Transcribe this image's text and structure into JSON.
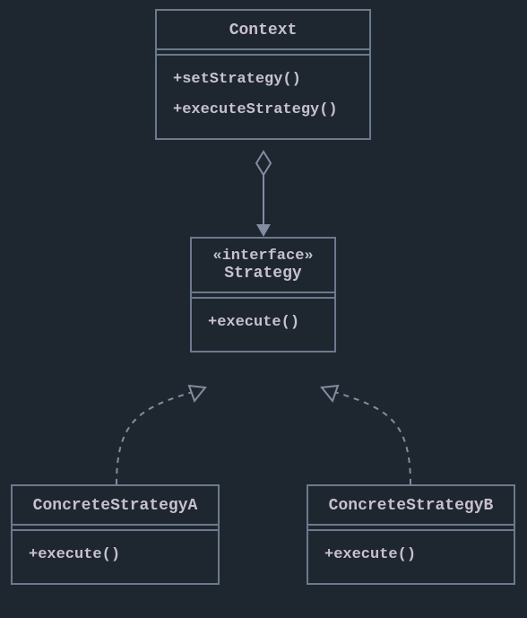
{
  "diagram": {
    "type": "uml-class",
    "pattern_name": "Strategy",
    "classes": {
      "context": {
        "name": "Context",
        "methods": [
          "+setStrategy()",
          "+executeStrategy()"
        ]
      },
      "strategy": {
        "stereotype": "«interface»",
        "name": "Strategy",
        "methods": [
          "+execute()"
        ]
      },
      "concreteA": {
        "name": "ConcreteStrategyA",
        "methods": [
          "+execute()"
        ]
      },
      "concreteB": {
        "name": "ConcreteStrategyB",
        "methods": [
          "+execute()"
        ]
      }
    },
    "relations": [
      {
        "from": "context",
        "to": "strategy",
        "type": "aggregation"
      },
      {
        "from": "concreteA",
        "to": "strategy",
        "type": "realization"
      },
      {
        "from": "concreteB",
        "to": "strategy",
        "type": "realization"
      }
    ]
  }
}
